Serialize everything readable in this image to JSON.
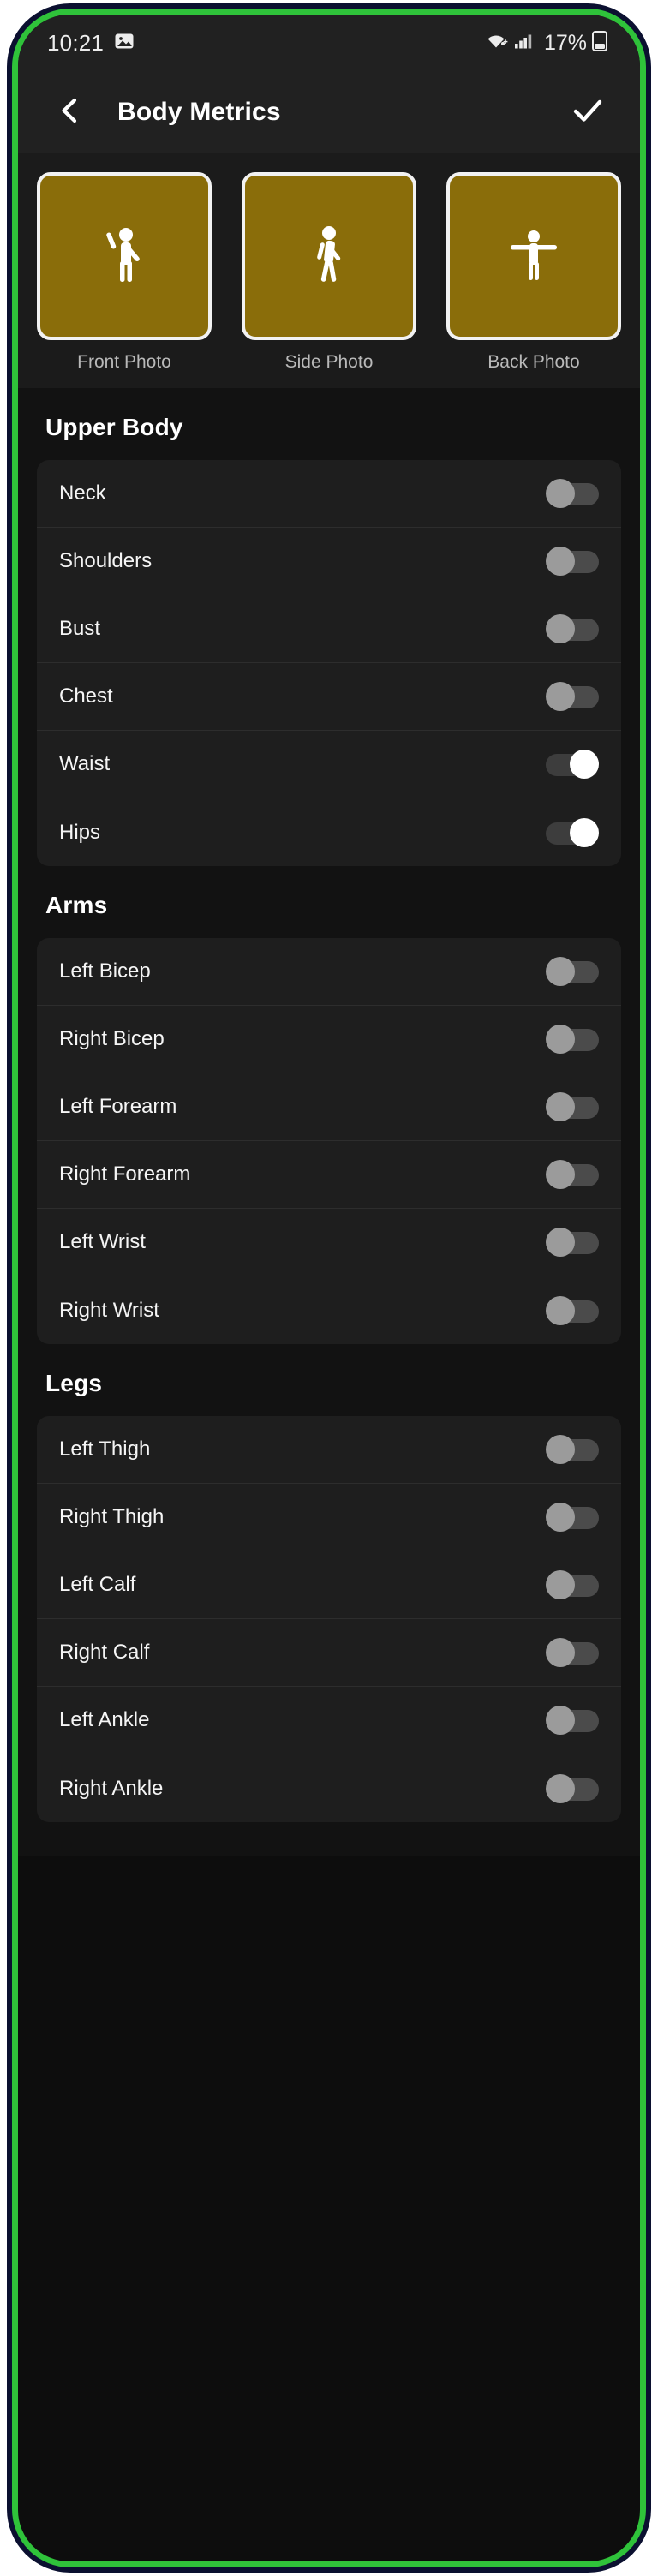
{
  "status_bar": {
    "time": "10:21",
    "screenshot_icon": "image-icon",
    "wifi_icon": "wifi-icon",
    "signal_icon": "cellular-signal-icon",
    "battery_percent": "17%",
    "battery_icon": "battery-icon"
  },
  "app_bar": {
    "back_icon": "back-chevron-icon",
    "title": "Body Metrics",
    "confirm_icon": "checkmark-icon"
  },
  "photos": [
    {
      "label": "Front Photo",
      "icon": "person-waving-icon"
    },
    {
      "label": "Side Photo",
      "icon": "person-walking-icon"
    },
    {
      "label": "Back Photo",
      "icon": "person-arms-out-icon"
    }
  ],
  "sections": [
    {
      "title": "Upper Body",
      "rows": [
        {
          "label": "Neck",
          "enabled": false
        },
        {
          "label": "Shoulders",
          "enabled": false
        },
        {
          "label": "Bust",
          "enabled": false
        },
        {
          "label": "Chest",
          "enabled": false
        },
        {
          "label": "Waist",
          "enabled": true
        },
        {
          "label": "Hips",
          "enabled": true
        }
      ]
    },
    {
      "title": "Arms",
      "rows": [
        {
          "label": "Left Bicep",
          "enabled": false
        },
        {
          "label": "Right Bicep",
          "enabled": false
        },
        {
          "label": "Left Forearm",
          "enabled": false
        },
        {
          "label": "Right Forearm",
          "enabled": false
        },
        {
          "label": "Left Wrist",
          "enabled": false
        },
        {
          "label": "Right Wrist",
          "enabled": false
        }
      ]
    },
    {
      "title": "Legs",
      "rows": [
        {
          "label": "Left Thigh",
          "enabled": false
        },
        {
          "label": "Right Thigh",
          "enabled": false
        },
        {
          "label": "Left Calf",
          "enabled": false
        },
        {
          "label": "Right Calf",
          "enabled": false
        },
        {
          "label": "Left Ankle",
          "enabled": false
        },
        {
          "label": "Right Ankle",
          "enabled": false
        }
      ]
    }
  ],
  "colors": {
    "frame_green": "#2fc23a",
    "frame_navy": "#0b1030",
    "screen_bg": "#121212",
    "bar_bg": "#212121",
    "card_bg": "#1e1e1e",
    "photo_tile": "#8a6d0a",
    "toggle_on_thumb": "#ffffff",
    "toggle_off_thumb": "#9b9b9b",
    "toggle_track": "#4b4b4b"
  }
}
